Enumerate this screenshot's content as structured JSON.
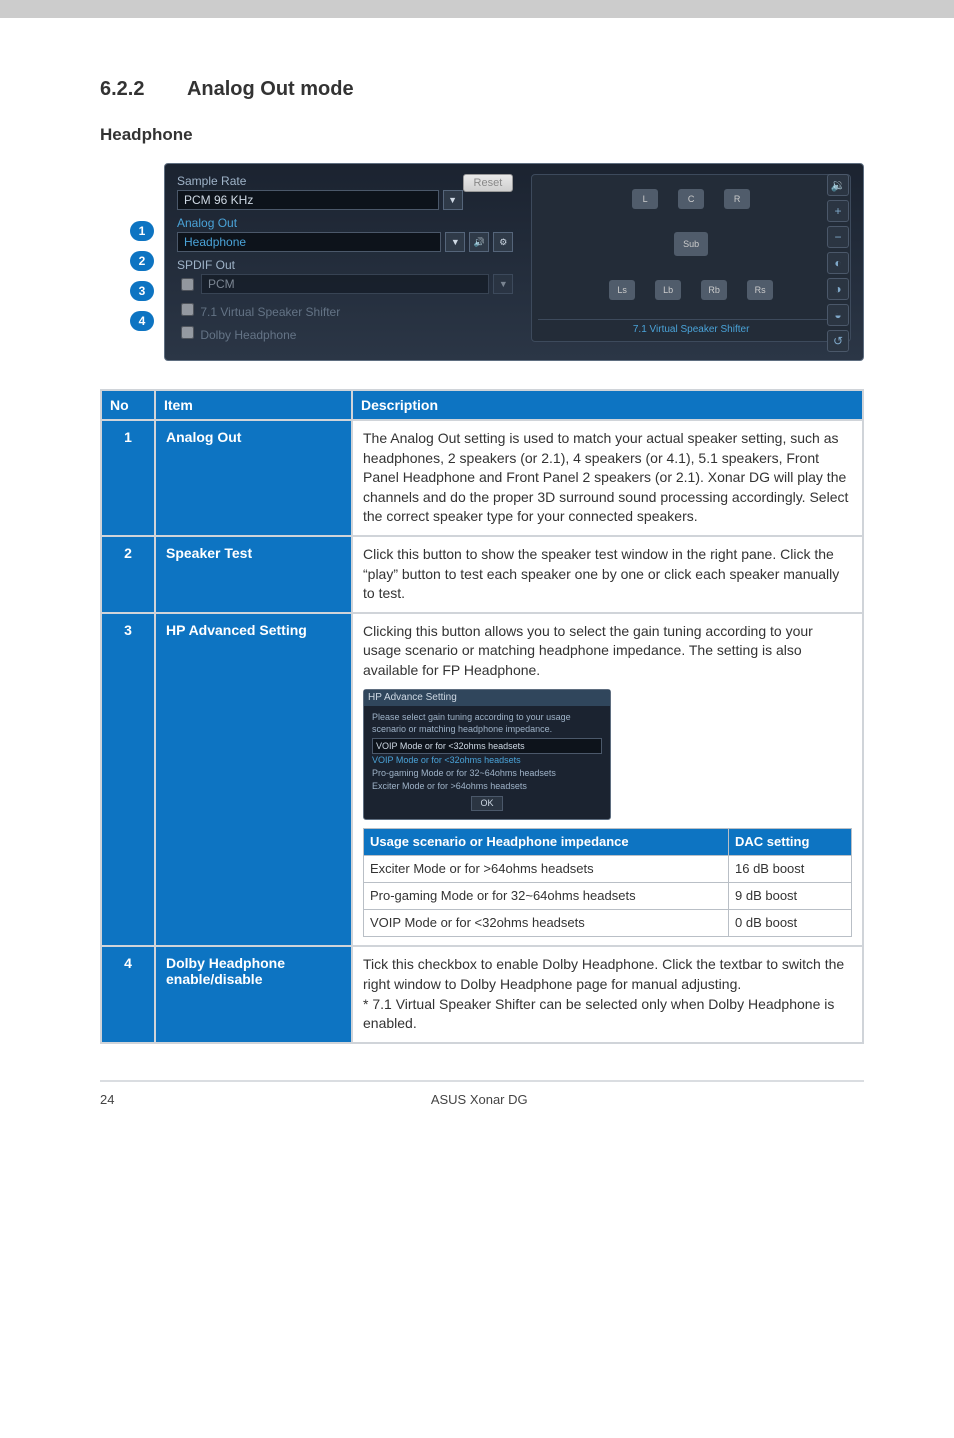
{
  "section": {
    "number": "6.2.2",
    "title": "Analog Out mode"
  },
  "subhead": "Headphone",
  "callouts": [
    "1",
    "2",
    "3",
    "4"
  ],
  "screenshot": {
    "sample_rate_label": "Sample Rate",
    "sample_rate_value": "PCM 96 KHz",
    "analog_out_label": "Analog Out",
    "analog_out_value": "Headphone",
    "spdif_label": "SPDIF Out",
    "spdif_value": "PCM",
    "vss_label": "7.1 Virtual Speaker Shifter",
    "dolby_label": "Dolby Headphone",
    "reset_btn": "Reset",
    "speakers": {
      "l": "L",
      "c": "C",
      "r": "R",
      "sub": "Sub",
      "ls": "Ls",
      "lb": "Lb",
      "rb": "Rb",
      "rs": "Rs"
    },
    "vss_footer": "7.1 Virtual Speaker Shifter",
    "side": {
      "vol": "🔉",
      "plus": "+",
      "minus": "−"
    }
  },
  "table": {
    "headers": {
      "no": "No",
      "item": "Item",
      "desc": "Description"
    },
    "rows": [
      {
        "no": "1",
        "item": "Analog Out",
        "desc": "The Analog Out setting is used to match your actual speaker setting, such as headphones, 2 speakers (or 2.1), 4 speakers (or 4.1), 5.1 speakers, Front Panel Headphone and Front Panel 2 speakers (or 2.1). Xonar DG will play the channels and do the proper 3D surround sound processing accordingly. Select the correct speaker type for your connected speakers."
      },
      {
        "no": "2",
        "item": "Speaker Test",
        "desc": "Click this button to show the speaker test window in the right pane. Click the “play” button to test each speaker one by one or click each speaker manually to test."
      },
      {
        "no": "3",
        "item": "HP Advanced Setting",
        "desc_top": "Clicking this button allows you to select the gain tuning according to your usage scenario or matching headphone impedance. The setting is also available for FP Headphone.",
        "mini": {
          "title": "HP Advance Setting",
          "line1": "Please select gain tuning according to your usage",
          "line2": "scenario or matching headphone impedance.",
          "opt1": "VOIP Mode or for <32ohms headsets",
          "opt2": "VOIP Mode or for <32ohms headsets",
          "opt3": "Pro-gaming Mode or for 32~64ohms headsets",
          "opt4": "Exciter Mode or for >64ohms headsets",
          "ok": "OK"
        },
        "inner_headers": {
          "scenario": "Usage scenario or Headphone impedance",
          "dac": "DAC setting"
        },
        "inner_rows": [
          {
            "scenario": "Exciter Mode or for >64ohms headsets",
            "dac": "16 dB boost"
          },
          {
            "scenario": "Pro-gaming Mode or for 32~64ohms headsets",
            "dac": "9 dB boost"
          },
          {
            "scenario": "VOIP Mode or for <32ohms headsets",
            "dac": "0 dB boost"
          }
        ]
      },
      {
        "no": "4",
        "item": "Dolby Headphone enable/disable",
        "desc": "Tick this checkbox to enable Dolby Headphone. Click the textbar to switch the right window to Dolby Headphone page for manual adjusting.\n* 7.1 Virtual Speaker Shifter can be selected only when Dolby Headphone is enabled."
      }
    ]
  },
  "footer": {
    "page": "24",
    "product": "ASUS Xonar DG"
  }
}
